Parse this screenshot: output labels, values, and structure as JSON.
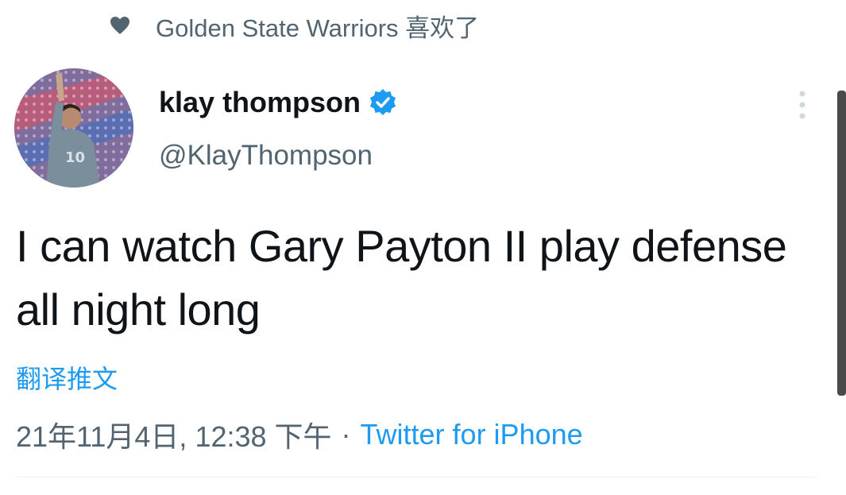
{
  "social_context": {
    "text": "Golden State Warriors 喜欢了",
    "icon": "heart-icon"
  },
  "author": {
    "display_name": "klay thompson",
    "handle": "@KlayThompson",
    "verified": true,
    "avatar": "avatar-photo"
  },
  "tweet": {
    "text": "I can watch Gary Payton II play defense all night long",
    "translate_label": "翻译推文"
  },
  "meta": {
    "timestamp": "21年11月4日, 12:38 下午",
    "separator": "·",
    "source": "Twitter for iPhone"
  },
  "colors": {
    "accent": "#1d9bf0",
    "text_primary": "#0f1419",
    "text_secondary": "#536471"
  },
  "icons": [
    "heart-icon",
    "verified-badge-icon",
    "more-options-icon"
  ]
}
